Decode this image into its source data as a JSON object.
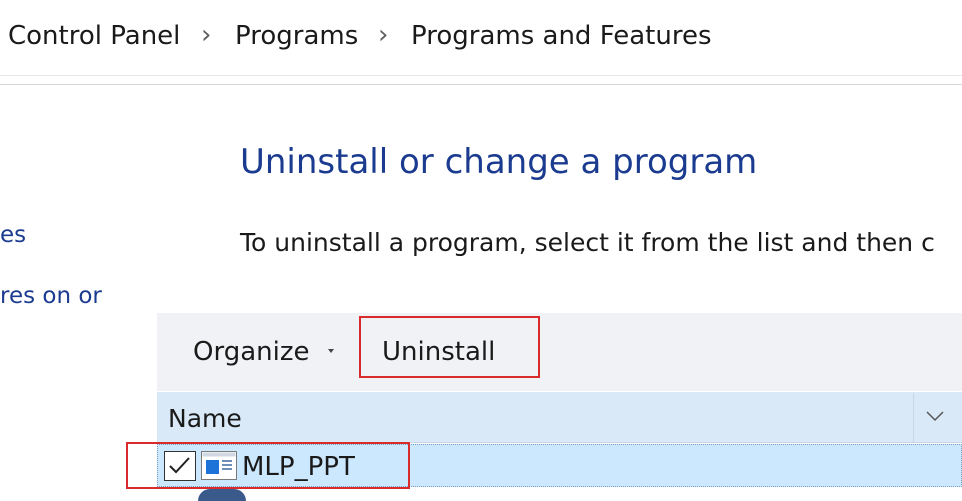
{
  "breadcrumb": {
    "items": [
      "Control Panel",
      "Programs",
      "Programs and Features"
    ],
    "separator_icon": "chevron-right-icon"
  },
  "sidebar": {
    "links": [
      "es",
      "res on or"
    ]
  },
  "main": {
    "title": "Uninstall or change a program",
    "description": "To uninstall a program, select it from the list and then c"
  },
  "toolbar": {
    "organize_label": "Organize",
    "uninstall_label": "Uninstall"
  },
  "list": {
    "columns": [
      {
        "label": "Name"
      }
    ],
    "rows": [
      {
        "name": "MLP_PPT",
        "checked": true,
        "selected": true
      }
    ]
  },
  "colors": {
    "link_blue": "#1a3b8f",
    "highlight_red": "#d92b2b",
    "selection_bg": "#cce8ff",
    "header_bg": "#d9e9f7",
    "toolbar_bg": "#f0f2f5"
  }
}
